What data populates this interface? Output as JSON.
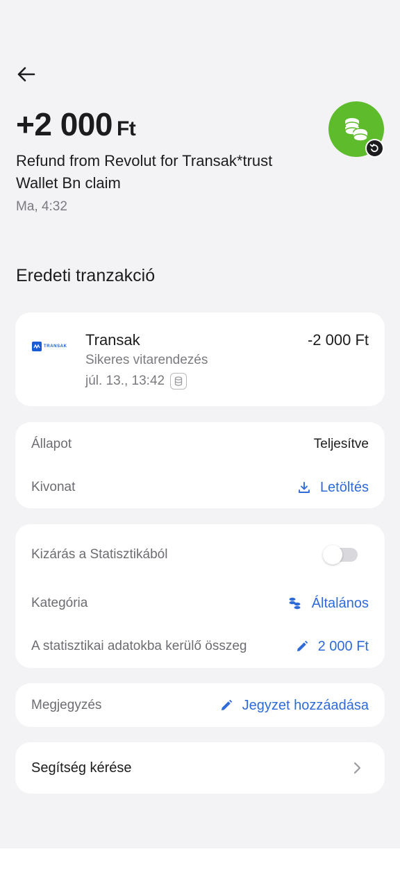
{
  "header": {
    "amount": "+2 000",
    "currency": "Ft",
    "description": "Refund from Revolut for Transak*trust Wallet Bn claim",
    "datetime": "Ma, 4:32"
  },
  "original_transaction": {
    "section_title": "Eredeti tranzakció",
    "merchant_logo_text": "TRANSAK",
    "merchant": "Transak",
    "amount": "-2 000 Ft",
    "status": "Sikeres vitarendezés",
    "date": "júl. 13., 13:42"
  },
  "details": {
    "status_label": "Állapot",
    "status_value": "Teljesítve",
    "statement_label": "Kivonat",
    "statement_action": "Letöltés"
  },
  "stats": {
    "exclude_label": "Kizárás a Statisztikából",
    "exclude_enabled": false,
    "category_label": "Kategória",
    "category_value": "Általános",
    "stats_amount_label": "A statisztikai adatokba kerülő összeg",
    "stats_amount_value": "2 000 Ft"
  },
  "note": {
    "label": "Megjegyzés",
    "action": "Jegyzet hozzáadása"
  },
  "help": {
    "label": "Segítség kérése"
  },
  "colors": {
    "accent": "#2f6bd8",
    "avatar_green": "#5dbb2c",
    "background": "#f3f3f5"
  },
  "icons": {
    "back": "arrow-left-icon",
    "avatar": "coins-icon",
    "refund_badge": "refund-icon",
    "download": "download-icon",
    "category": "coins-category-icon",
    "edit": "pencil-icon",
    "chevron": "chevron-right-icon"
  }
}
